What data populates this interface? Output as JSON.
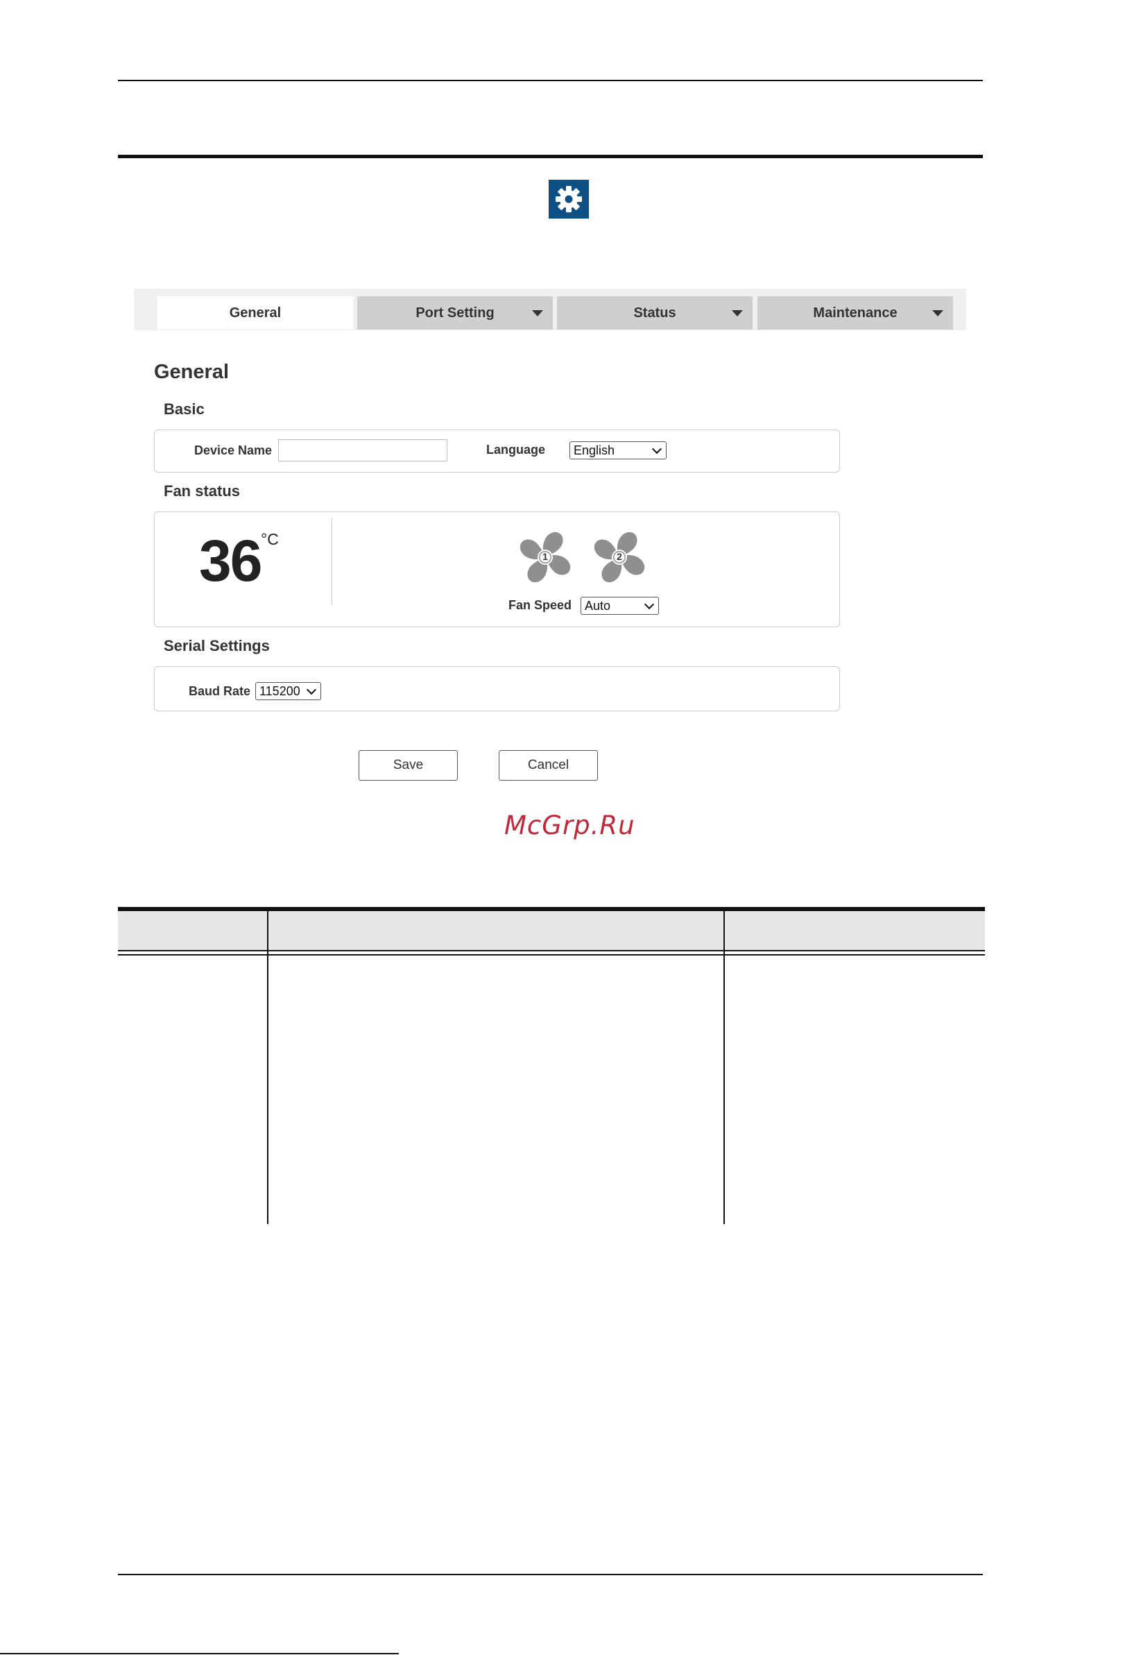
{
  "tabs": [
    {
      "label": "General",
      "active": true,
      "has_dropdown": false
    },
    {
      "label": "Port Setting",
      "active": false,
      "has_dropdown": true
    },
    {
      "label": "Status",
      "active": false,
      "has_dropdown": true
    },
    {
      "label": "Maintenance",
      "active": false,
      "has_dropdown": true
    }
  ],
  "page": {
    "title": "General"
  },
  "basic": {
    "heading": "Basic",
    "device_name_label": "Device Name",
    "device_name_value": "",
    "language_label": "Language",
    "language_value": "English"
  },
  "fan": {
    "heading": "Fan status",
    "temperature": "36",
    "unit": "°C",
    "fans": [
      "1",
      "2"
    ],
    "speed_label": "Fan Speed",
    "speed_value": "Auto"
  },
  "serial": {
    "heading": "Serial Settings",
    "baud_label": "Baud Rate",
    "baud_value": "115200"
  },
  "actions": {
    "save": "Save",
    "cancel": "Cancel"
  },
  "watermark": "McGrp.Ru",
  "icons": {
    "settings": "gear-icon",
    "fan": "fan-icon"
  },
  "colors": {
    "gear_bg": "#0e4f84",
    "tab_inactive": "#cfcfcf",
    "tab_bar": "#f0f0f0",
    "watermark": "#c0283a"
  }
}
